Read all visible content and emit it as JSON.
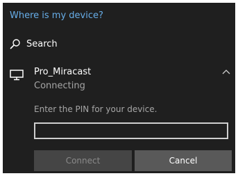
{
  "header": {
    "link_label": "Where is my device?"
  },
  "search": {
    "label": "Search",
    "icon": "search-icon"
  },
  "device": {
    "name": "Pro_Miracast",
    "status": "Connecting",
    "icon": "monitor-icon",
    "expanded": true
  },
  "pin": {
    "prompt": "Enter the PIN for your device.",
    "value": "",
    "placeholder": ""
  },
  "buttons": {
    "connect_label": "Connect",
    "connect_enabled": false,
    "cancel_label": "Cancel"
  },
  "colors": {
    "background": "#1f1f1f",
    "link": "#67aee9",
    "secondary_text": "#a6a6a6",
    "disabled_button": "#454545",
    "button": "#595959"
  }
}
